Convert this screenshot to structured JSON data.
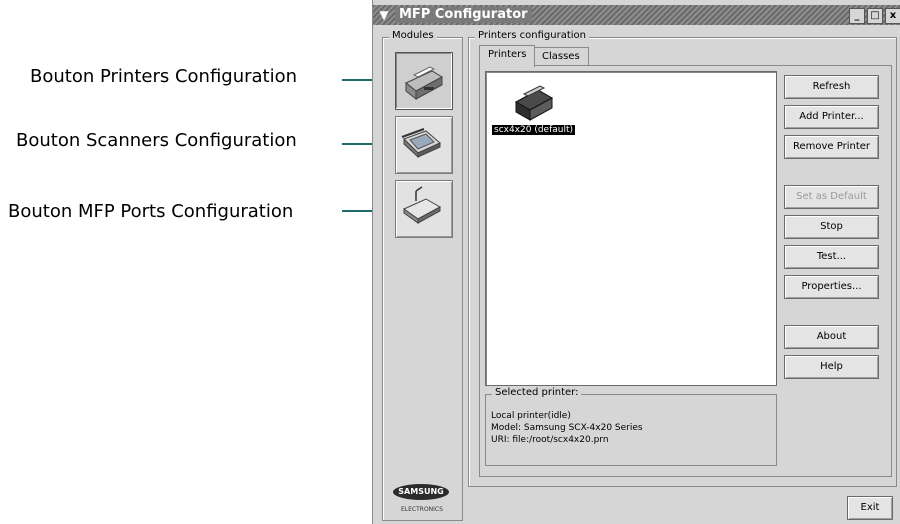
{
  "callouts": [
    {
      "label": "Bouton Printers Configuration"
    },
    {
      "label": "Bouton Scanners Configuration"
    },
    {
      "label": "Bouton MFP Ports Configuration"
    }
  ],
  "window": {
    "title": "MFP Configurator",
    "controls": [
      "_",
      "□",
      "x"
    ]
  },
  "modules": {
    "legend": "Modules",
    "items": [
      {
        "name": "printers",
        "icon": "printer-icon",
        "active": true
      },
      {
        "name": "scanners",
        "icon": "scanner-icon",
        "active": false
      },
      {
        "name": "ports",
        "icon": "port-icon",
        "active": false
      }
    ],
    "brand": "SAMSUNG",
    "brand_sub": "ELECTRONICS"
  },
  "printers_config": {
    "legend": "Printers configuration",
    "tabs": [
      "Printers",
      "Classes"
    ],
    "active_tab": "Printers",
    "printer_item": "scx4x20 (default)",
    "buttons": {
      "refresh": "Refresh",
      "add": "Add Printer...",
      "remove": "Remove Printer",
      "set_default": "Set as Default",
      "stop": "Stop",
      "test": "Test...",
      "properties": "Properties...",
      "about": "About",
      "help": "Help"
    },
    "selected": {
      "legend": "Selected printer:",
      "status": "Local printer(idle)",
      "model": "Model: Samsung SCX-4x20 Series",
      "uri": "URI: file:/root/scx4x20.prn"
    }
  },
  "footer": {
    "exit": "Exit"
  },
  "colors": {
    "leader": "#1f6b6b",
    "window_bg": "#d6d6d6"
  }
}
